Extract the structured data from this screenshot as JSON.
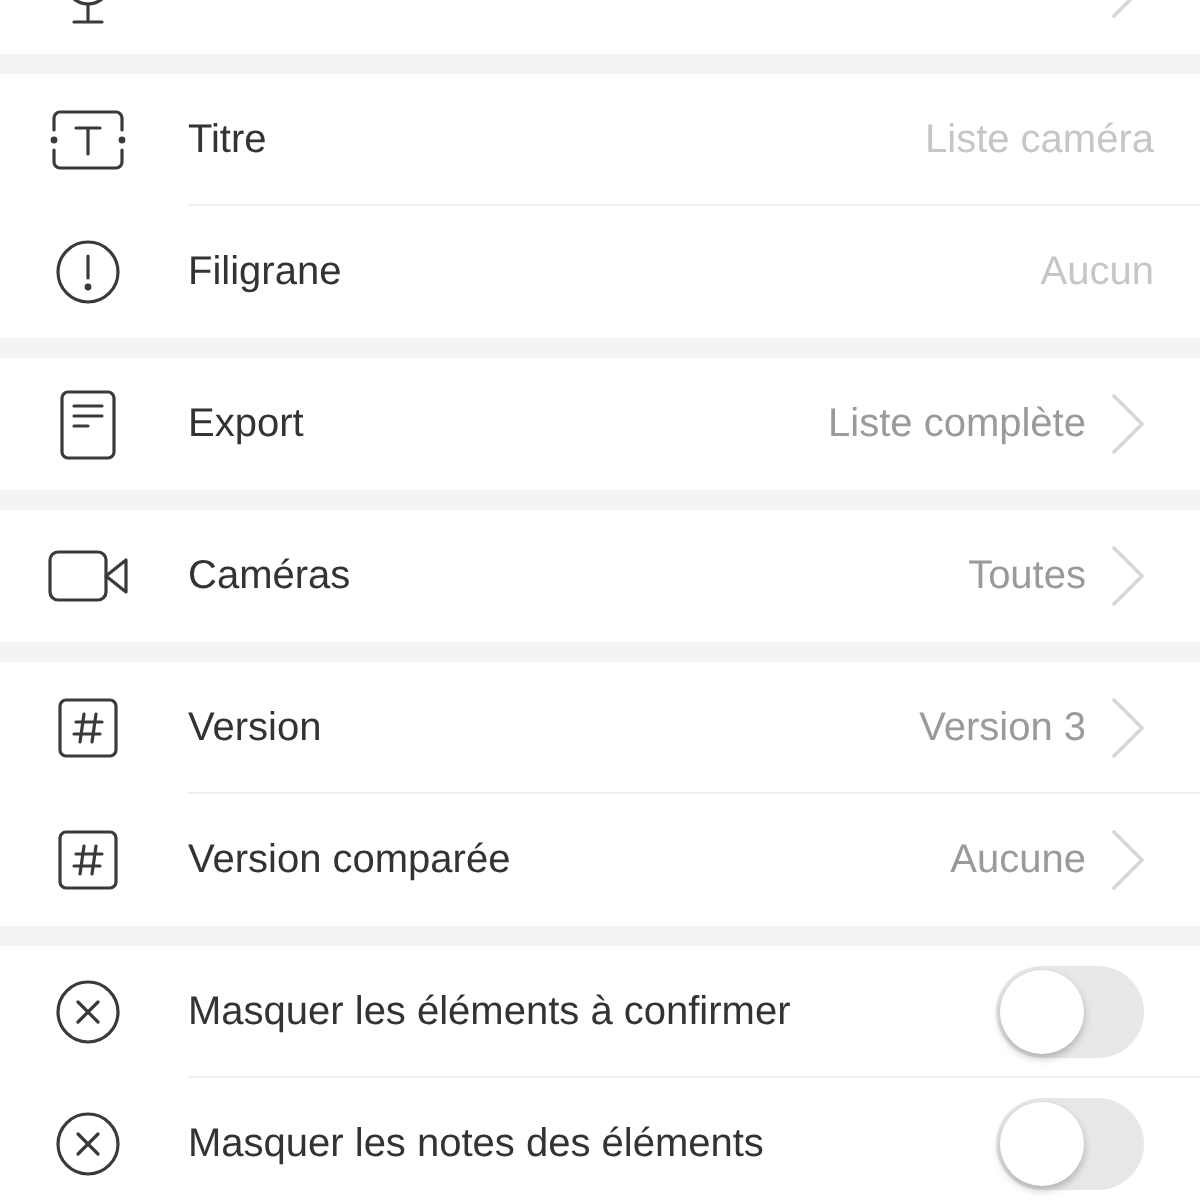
{
  "sections": [
    {
      "rows": [
        {
          "kind": "link"
        }
      ]
    },
    {
      "rows": [
        {
          "kind": "input",
          "label": "Titre",
          "placeholder": "Liste caméra"
        },
        {
          "kind": "input",
          "label": "Filigrane",
          "placeholder": "Aucun"
        }
      ]
    },
    {
      "rows": [
        {
          "kind": "link",
          "label": "Export",
          "value": "Liste complète"
        }
      ]
    },
    {
      "rows": [
        {
          "kind": "link",
          "label": "Caméras",
          "value": "Toutes"
        }
      ]
    },
    {
      "rows": [
        {
          "kind": "link",
          "label": "Version",
          "value": "Version 3"
        },
        {
          "kind": "link",
          "label": "Version comparée",
          "value": "Aucune"
        }
      ]
    },
    {
      "rows": [
        {
          "kind": "toggle",
          "label": "Masquer les éléments à confirmer",
          "on": false
        },
        {
          "kind": "toggle",
          "label": "Masquer les notes des éléments",
          "on": false
        }
      ]
    }
  ]
}
